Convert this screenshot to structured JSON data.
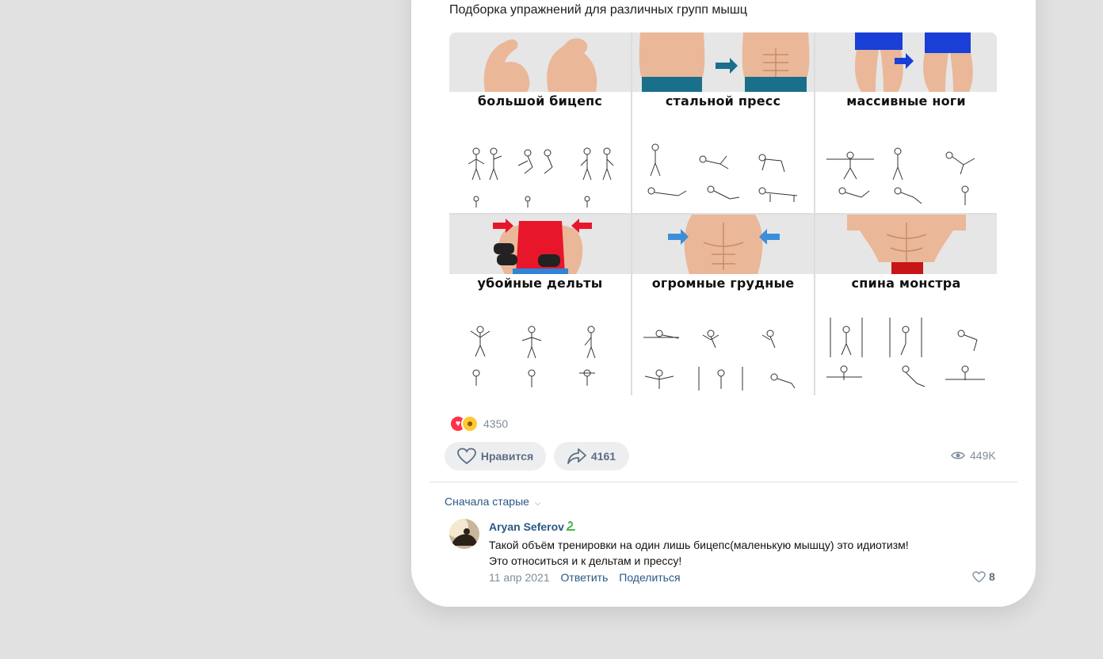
{
  "post": {
    "text": "Подборка упражнений для различных групп мышц",
    "tiles": [
      {
        "caption": "большой бицепс",
        "photo": "biceps-photo"
      },
      {
        "caption": "стальной пресс",
        "photo": "abs-photo"
      },
      {
        "caption": "массивные ноги",
        "photo": "legs-photo"
      },
      {
        "caption": "убойные дельты",
        "photo": "delts-photo"
      },
      {
        "caption": "огромные грудные",
        "photo": "chest-photo"
      },
      {
        "caption": "спина монстра",
        "photo": "back-photo"
      }
    ],
    "reactions": {
      "icons": [
        "heart-reaction-icon",
        "laugh-reaction-icon"
      ],
      "count": "4350"
    },
    "like_label": "Нравится",
    "share_count": "4161",
    "views": "449K"
  },
  "comments": {
    "sort_label": "Сначала старые",
    "items": [
      {
        "author": "Aryan Seferov",
        "badge_icon": "snake-badge-icon",
        "line1": "Такой объём тренировки на один лишь бицепс(маленькую мышцу) это идиотизм!",
        "line2": "Это относиться и к дельтам и прессу!",
        "date": "11 апр 2021",
        "reply_label": "Ответить",
        "share_label": "Поделиться",
        "likes": "8"
      }
    ]
  },
  "colors": {
    "background": "#e1e1e1",
    "card": "#ffffff",
    "link": "#2a5885",
    "secondary_text": "#818c99",
    "button_bg": "#edeef0",
    "reaction_heart": "#ff3347"
  }
}
